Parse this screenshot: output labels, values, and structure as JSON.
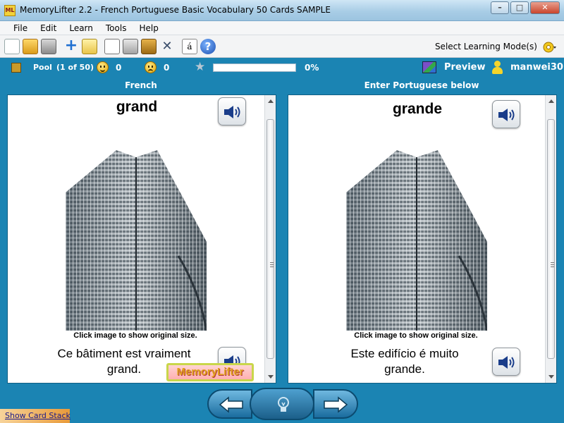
{
  "window": {
    "app_icon_text": "ML",
    "title": "MemoryLifter 2.2 - French Portuguese Basic Vocabulary 50 Cards SAMPLE",
    "minimize": "–",
    "maximize": "□",
    "close": "✕"
  },
  "menu": {
    "items": [
      "File",
      "Edit",
      "Learn",
      "Tools",
      "Help"
    ]
  },
  "toolbar": {
    "add_glyph": "+",
    "tools_glyph": "✕",
    "char_glyph": "á",
    "help_glyph": "?",
    "select_mode_label": "Select Learning Mode(s)"
  },
  "status": {
    "pool_label": "Pool",
    "pool_count": "(1 of 50)",
    "known_count": "0",
    "unknown_count": "0",
    "star_glyph": "★",
    "progress": 0,
    "progress_text": "0%",
    "preview_label": "Preview",
    "user_label": "manwei30"
  },
  "question": {
    "header": "French",
    "word": "grand",
    "caption": "Click image to show original size.",
    "sentence_line1": "Ce bâtiment est vraiment",
    "sentence_line2": "grand."
  },
  "answer": {
    "header": "Enter Portuguese below",
    "word": "grande",
    "caption": "Click image to show original size.",
    "sentence_line1": "Este edifício é muito",
    "sentence_line2": "grande."
  },
  "watermark": {
    "text": "MemoryLifter"
  },
  "footer": {
    "show_card_stack": "Show Card Stack"
  },
  "icons": {
    "audio": "speaker-icon",
    "prev": "arrow-left-icon",
    "next": "arrow-right-icon",
    "hint": "lightbulb-icon"
  },
  "colors": {
    "accent": "#1b84b3",
    "smile": "#f0c020",
    "progress_fill": "#3fb04b"
  }
}
